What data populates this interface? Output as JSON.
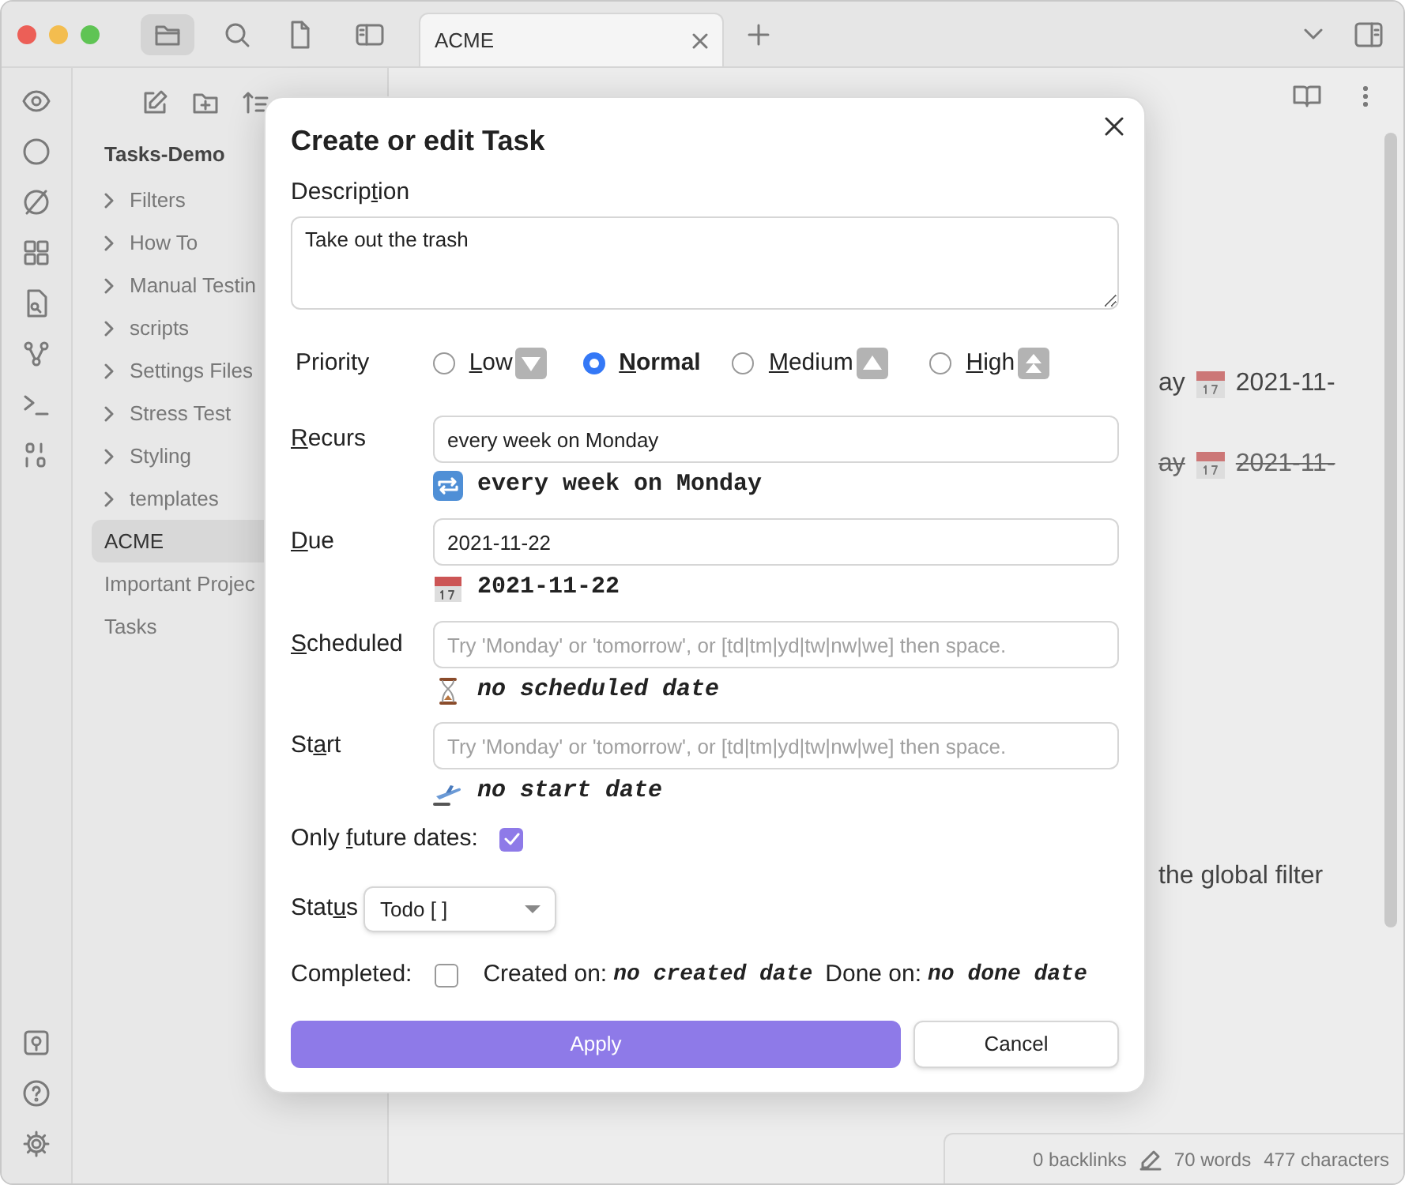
{
  "tab": {
    "title": "ACME"
  },
  "explorer": {
    "vault": "Tasks-Demo",
    "items": [
      {
        "label": "Filters",
        "kind": "folder",
        "selected": false
      },
      {
        "label": "How To",
        "kind": "folder",
        "selected": false
      },
      {
        "label": "Manual Testin",
        "kind": "folder",
        "selected": false
      },
      {
        "label": "scripts",
        "kind": "folder",
        "selected": false
      },
      {
        "label": "Settings Files",
        "kind": "folder",
        "selected": false
      },
      {
        "label": "Stress Test",
        "kind": "folder",
        "selected": false
      },
      {
        "label": "Styling",
        "kind": "folder",
        "selected": false
      },
      {
        "label": "templates",
        "kind": "folder",
        "selected": false
      },
      {
        "label": "ACME",
        "kind": "file",
        "selected": true
      },
      {
        "label": "Important Projec",
        "kind": "file",
        "selected": false
      },
      {
        "label": "Tasks",
        "kind": "file",
        "selected": false
      }
    ]
  },
  "editor": {
    "lines": [
      {
        "kind": "task",
        "text": "ay",
        "date": "2021-11-",
        "done": false
      },
      {
        "kind": "task",
        "text": "ay",
        "date": "2021-11-",
        "done": true
      },
      {
        "kind": "text",
        "text": "the global filter"
      }
    ]
  },
  "status_bar": {
    "backlinks": "0 backlinks",
    "words": "70 words",
    "characters": "477 characters"
  },
  "dialog": {
    "title": "Create or edit Task",
    "description": {
      "label": {
        "before": "Descrip",
        "key": "t",
        "after": "ion"
      },
      "value": "Take out the trash"
    },
    "priority": {
      "label": "Priority",
      "options": [
        {
          "label": {
            "key": "L",
            "after": "ow"
          },
          "kind": "low",
          "selected": false
        },
        {
          "label": {
            "key": "N",
            "after": "ormal"
          },
          "kind": "normal",
          "selected": true
        },
        {
          "label": {
            "key": "M",
            "after": "edium"
          },
          "kind": "medium",
          "selected": false
        },
        {
          "label": {
            "key": "H",
            "after": "igh"
          },
          "kind": "high",
          "selected": false
        }
      ]
    },
    "dates": [
      {
        "kind": "recurs",
        "label": {
          "key": "R",
          "after": "ecurs"
        },
        "value": "every week on Monday",
        "preview": "every week on Monday"
      },
      {
        "kind": "due",
        "label": {
          "key": "D",
          "after": "ue"
        },
        "value": "2021-11-22",
        "preview": "2021-11-22"
      },
      {
        "kind": "scheduled",
        "label": {
          "key": "S",
          "after": "cheduled"
        },
        "placeholder": "Try 'Monday' or 'tomorrow', or [td|tm|yd|tw|nw|we] then space.",
        "preview": "no scheduled date"
      },
      {
        "kind": "start",
        "label": {
          "before": "St",
          "key": "a",
          "after": "rt"
        },
        "placeholder": "Try 'Monday' or 'tomorrow', or [td|tm|yd|tw|nw|we] then space.",
        "preview": "no start date"
      }
    ],
    "only_future_dates": {
      "label": {
        "before": "Only ",
        "key": "f",
        "after": "uture dates:"
      },
      "checked": true
    },
    "status": {
      "label": {
        "before": "Stat",
        "key": "u",
        "after": "s"
      },
      "value": "Todo [ ]"
    },
    "completed": {
      "label": "Completed:",
      "checked": false
    },
    "created": {
      "label": "Created on:",
      "value": "no created date"
    },
    "done": {
      "label": "Done on:",
      "value": "no done date"
    },
    "buttons": [
      {
        "label": "Apply",
        "kind": "primary"
      },
      {
        "label": "Cancel",
        "kind": "secondary"
      }
    ]
  }
}
